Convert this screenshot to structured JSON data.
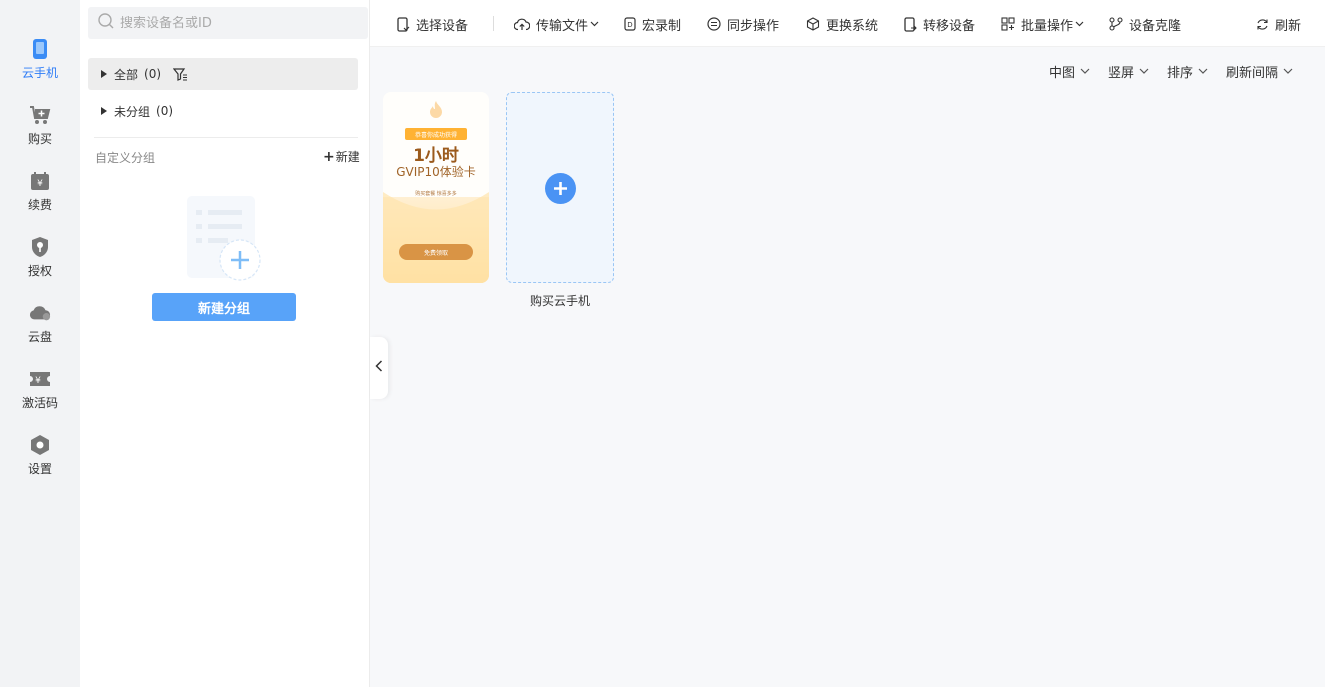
{
  "nav": {
    "items": [
      {
        "label": "云手机",
        "icon": "phone-icon",
        "active": true
      },
      {
        "label": "购买",
        "icon": "cart-icon"
      },
      {
        "label": "续费",
        "icon": "renew-calendar-icon"
      },
      {
        "label": "授权",
        "icon": "shield-key-icon"
      },
      {
        "label": "云盘",
        "icon": "cloud-icon"
      },
      {
        "label": "激活码",
        "icon": "ticket-icon"
      },
      {
        "label": "设置",
        "icon": "settings-hex-icon"
      }
    ]
  },
  "groups": {
    "search_placeholder": "搜索设备名或ID",
    "all": {
      "label": "全部",
      "count": "(0)"
    },
    "ungrouped": {
      "label": "未分组",
      "count": "(0)"
    },
    "custom_label": "自定义分组",
    "new_label": "新建",
    "new_group_button": "新建分组"
  },
  "toolbar": {
    "select_device": "选择设备",
    "transfer_file": "传输文件",
    "macro_record": "宏录制",
    "sync_operation": "同步操作",
    "change_system": "更换系统",
    "transfer_device": "转移设备",
    "batch_operation": "批量操作",
    "device_clone": "设备克隆",
    "refresh": "刷新"
  },
  "view_options": {
    "size": "中图",
    "orientation": "竖屏",
    "sort": "排序",
    "refresh_interval": "刷新间隔"
  },
  "promo_card": {
    "tag": "恭喜你成功获得",
    "duration": "1小时",
    "title": "GVIP10体验卡",
    "subtitle": "购买套餐 惊喜多多",
    "claim_button": "免费领取"
  },
  "buy_card": {
    "label": "购买云手机"
  },
  "colors": {
    "accent": "#2e7cf6",
    "primary_button": "#58a3f9",
    "promo_gold": "#d99445"
  }
}
